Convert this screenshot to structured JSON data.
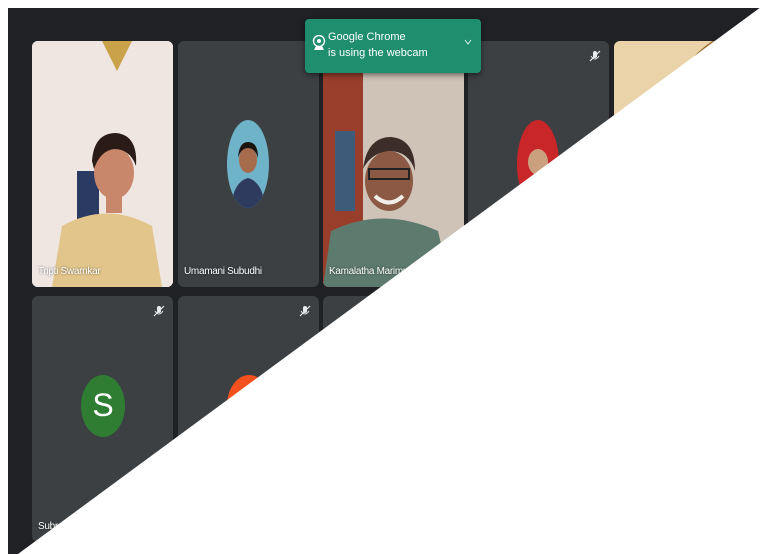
{
  "notification": {
    "title": "Google Chrome",
    "message": "is using the webcam",
    "icon": "webcam-icon",
    "accent": "#1e8e6e"
  },
  "participants": [
    {
      "name": "Tripti Swarnkar",
      "type": "video",
      "muted": false
    },
    {
      "name": "Umamani Subudhi",
      "type": "photo-avatar",
      "muted": false
    },
    {
      "name": "Kamalatha Marimuthu",
      "type": "video",
      "muted": false
    },
    {
      "name": "",
      "type": "photo-avatar",
      "muted": true
    },
    {
      "name": "",
      "type": "video",
      "muted": false
    },
    {
      "name": "Subramaniam",
      "type": "letter-avatar",
      "avatar_letter": "S",
      "avatar_color": "#2e7d32",
      "muted": true
    },
    {
      "name": "",
      "type": "letter-avatar",
      "avatar_color": "#f4511e",
      "muted": true
    },
    {
      "name": "",
      "type": "unknown",
      "muted": false
    }
  ],
  "colors": {
    "background": "#202124",
    "tile": "#3c4043"
  }
}
